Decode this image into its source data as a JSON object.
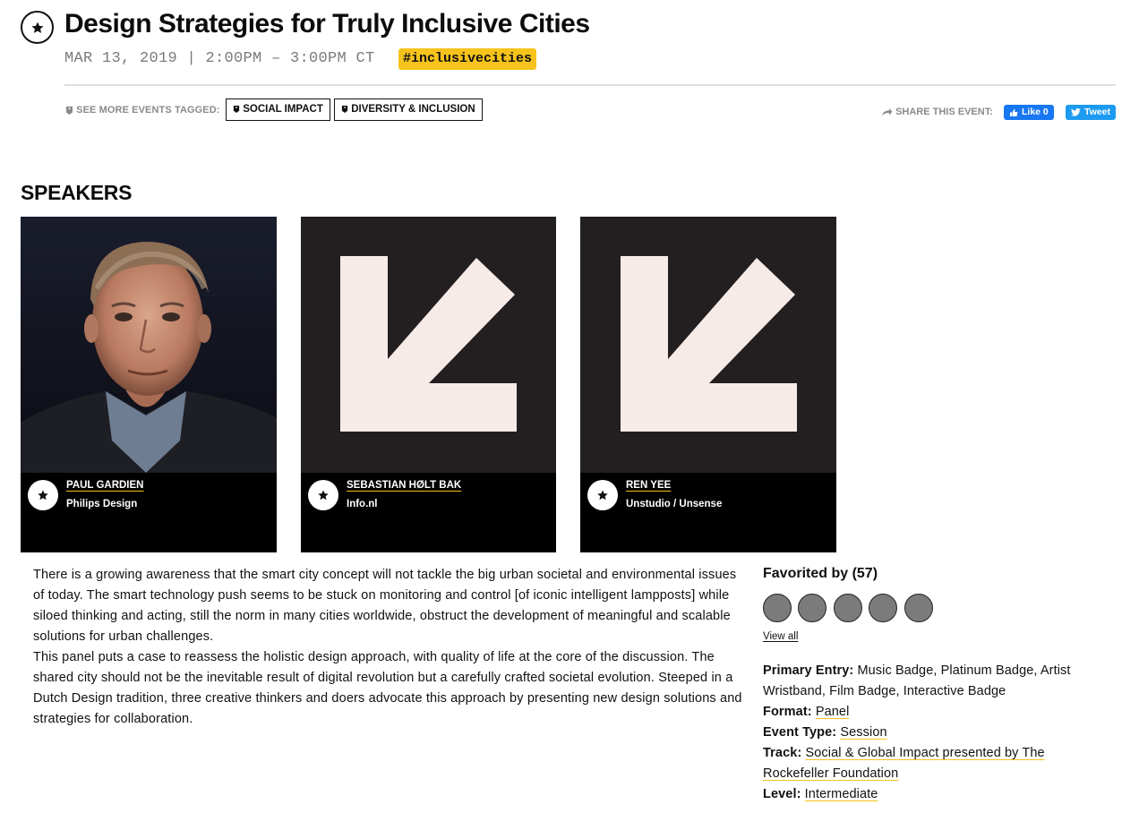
{
  "event": {
    "title": "Design Strategies for Truly Inclusive Cities",
    "datetime": "MAR 13, 2019 | 2:00PM – 3:00PM CT",
    "hashtag": "#inclusivecities"
  },
  "tags": {
    "label": "SEE MORE EVENTS TAGGED:",
    "items": [
      "SOCIAL IMPACT",
      "DIVERSITY & INCLUSION"
    ]
  },
  "share": {
    "label": "SHARE THIS EVENT:",
    "like_label": "Like 0",
    "tweet_label": "Tweet",
    "like_color": "#1877f2",
    "tweet_color": "#1d9bf0"
  },
  "speakers": {
    "heading": "SPEAKERS",
    "items": [
      {
        "name": "PAUL GARDIEN",
        "org": "Philips Design"
      },
      {
        "name": "SEBASTIAN HØLT BAK",
        "org": "Info.nl"
      },
      {
        "name": "REN YEE",
        "org": "Unstudio / Unsense"
      }
    ]
  },
  "description": {
    "paragraphs": [
      "There is a growing awareness that the smart city concept will not tackle the big urban societal and environmental issues of today. The smart technology push seems to be stuck on monitoring and control [of iconic intelligent lampposts] while siloed thinking and acting, still the norm in many cities worldwide, obstruct the development of meaningful and scalable solutions for urban challenges.",
      "This panel puts a case to reassess the holistic design approach, with quality of life at the core of the discussion. The shared city should not be the inevitable result of digital revolution but a carefully crafted societal evolution. Steeped in a Dutch Design tradition, three creative thinkers and doers advocate this approach by presenting new design solutions and strategies for collaboration."
    ]
  },
  "favorited": {
    "heading": "Favorited by (57)",
    "view_all": "View all"
  },
  "meta": {
    "primary_entry_label": "Primary Entry:",
    "primary_entry_value": "Music Badge, Platinum Badge, Artist Wristband, Film Badge, Interactive Badge",
    "format_label": "Format:",
    "format_value": "Panel",
    "event_type_label": "Event Type:",
    "event_type_value": "Session",
    "track_label": "Track:",
    "track_value": "Social & Global Impact presented by The Rockefeller Foundation",
    "level_label": "Level:",
    "level_value": "Intermediate"
  },
  "colors": {
    "accent_yellow": "#f5c31b",
    "placeholder_bg": "#231f20",
    "placeholder_arrow": "#f7ebe8"
  },
  "icons": [
    "star-icon",
    "tag-icon",
    "share-arrow-icon",
    "facebook-thumb-icon",
    "twitter-bird-icon",
    "placeholder-arrow-icon"
  ]
}
